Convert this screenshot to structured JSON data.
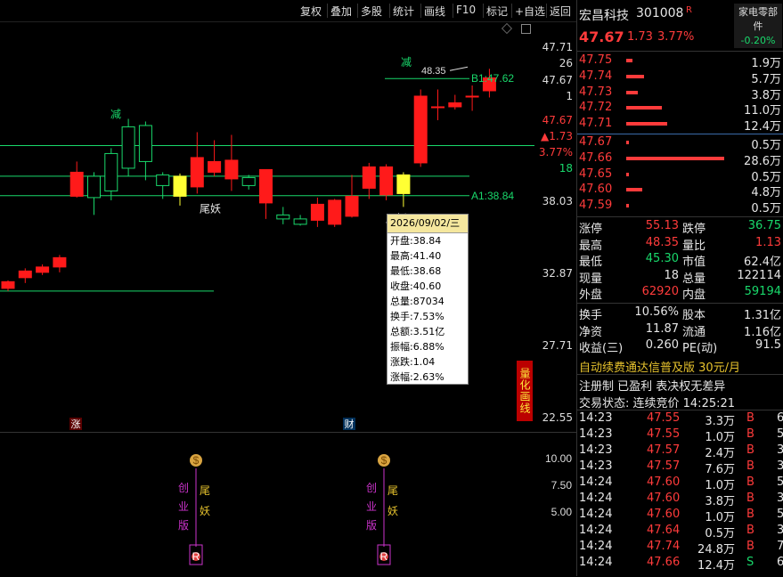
{
  "toolbar": {
    "items": [
      "复权",
      "叠加",
      "多股",
      "统计",
      "画线",
      "F10",
      "标记",
      "+自选",
      "返回"
    ]
  },
  "chart_data": {
    "type": "candlestick",
    "candles": [
      {
        "o": 31.9,
        "c": 32.4,
        "h": 32.5,
        "l": 31.7
      },
      {
        "o": 32.7,
        "c": 33.2,
        "h": 33.4,
        "l": 32.3
      },
      {
        "o": 33.1,
        "c": 33.5,
        "h": 33.7,
        "l": 32.9
      },
      {
        "o": 33.5,
        "c": 34.2,
        "h": 34.4,
        "l": 33.1
      },
      {
        "o": 38.8,
        "c": 40.6,
        "h": 41.4,
        "l": 38.7
      },
      {
        "o": 40.3,
        "c": 38.7,
        "h": 40.6,
        "l": 37.4
      },
      {
        "o": 42.0,
        "c": 39.2,
        "h": 42.4,
        "l": 38.5
      },
      {
        "o": 44.0,
        "c": 40.9,
        "h": 44.6,
        "l": 40.3
      },
      {
        "o": 44.1,
        "c": 41.4,
        "h": 44.4,
        "l": 40.0
      },
      {
        "o": 40.4,
        "c": 39.6,
        "h": 40.6,
        "l": 38.6
      },
      {
        "o": 40.3,
        "c": 38.8,
        "h": 40.5,
        "l": 38.1
      },
      {
        "o": 39.5,
        "c": 41.7,
        "h": 43.6,
        "l": 39.0
      },
      {
        "o": 40.6,
        "c": 41.4,
        "h": 43.0,
        "l": 40.3
      },
      {
        "o": 40.1,
        "c": 41.5,
        "h": 43.4,
        "l": 39.2
      },
      {
        "o": 40.2,
        "c": 39.6,
        "h": 40.4,
        "l": 39.3
      },
      {
        "o": 38.3,
        "c": 40.8,
        "h": 40.8,
        "l": 37.1
      },
      {
        "o": 37.4,
        "c": 37.1,
        "h": 38.0,
        "l": 36.7
      },
      {
        "o": 37.1,
        "c": 36.7,
        "h": 37.4,
        "l": 36.6
      },
      {
        "o": 37.0,
        "c": 38.2,
        "h": 38.7,
        "l": 36.5
      },
      {
        "o": 36.7,
        "c": 38.5,
        "h": 38.6,
        "l": 36.5
      },
      {
        "o": 37.3,
        "c": 38.8,
        "h": 40.4,
        "l": 37.2
      },
      {
        "o": 39.4,
        "c": 41.0,
        "h": 41.3,
        "l": 38.6
      },
      {
        "o": 38.9,
        "c": 41.0,
        "h": 41.2,
        "l": 38.5
      },
      {
        "o": 40.4,
        "c": 39.0,
        "h": 40.6,
        "l": 38.0
      },
      {
        "o": 41.3,
        "c": 46.3,
        "h": 46.8,
        "l": 41.0
      },
      {
        "o": 45.5,
        "c": 45.5,
        "h": 46.8,
        "l": 44.5
      },
      {
        "o": 45.5,
        "c": 45.8,
        "h": 46.4,
        "l": 45.3
      },
      {
        "o": 46.3,
        "c": 46.3,
        "h": 47.1,
        "l": 45.2
      },
      {
        "o": 46.7,
        "c": 47.67,
        "h": 48.35,
        "l": 46.2
      }
    ],
    "ylim": [
      22.55,
      48.9
    ],
    "hlines": [
      {
        "y": 42.6,
        "color": "#19d86b"
      },
      {
        "y": 40.3,
        "color": "#19d86b"
      },
      {
        "y": 38.84,
        "color": "#19d86b"
      },
      {
        "y": 31.7,
        "color": "#19d86b"
      },
      {
        "y": 47.62,
        "color": "#19d86b"
      }
    ],
    "yticks": [
      "47.71",
      "26",
      "47.67",
      "1",
      "47.67",
      "▲1.73",
      "3.77%",
      "18",
      "38.03",
      "32.87",
      "27.71",
      "22.55"
    ],
    "annotations": {
      "b1": "B1:47.62",
      "a1": "A1:38.84",
      "high": "48.35",
      "jian": "减",
      "weiyao": "尾妖",
      "zhang": "涨",
      "cai": "财"
    },
    "sub_ticks": [
      "10.00",
      "7.50",
      "5.00"
    ]
  },
  "tooltip": {
    "date": "2026/09/02/三",
    "lines": [
      "开盘:38.84",
      "最高:41.40",
      "最低:38.68",
      "收盘:40.60",
      "总量:87034",
      "换手:7.53%",
      "总额:3.51亿",
      "振幅:6.88%",
      "涨跌:1.04",
      "涨幅:2.63%"
    ]
  },
  "badge": "量化画线",
  "sub_labels": {
    "cy": [
      "创",
      "业",
      "版"
    ],
    "wy": [
      "尾",
      "妖"
    ],
    "r": "R",
    "money": "$"
  },
  "stock": {
    "name": "宏昌科技",
    "code": "301008",
    "mark": "R",
    "sector": "家电零部件",
    "sector_change": "-0.20%",
    "price": "47.67",
    "change": "1.73",
    "pct": "3.77%"
  },
  "asks": [
    {
      "p": "47.75",
      "v": "1.9万",
      "w": 0.03
    },
    {
      "p": "47.74",
      "v": "5.7万",
      "w": 0.09
    },
    {
      "p": "47.73",
      "v": "3.8万",
      "w": 0.06
    },
    {
      "p": "47.72",
      "v": "11.0万",
      "w": 0.18
    },
    {
      "p": "47.71",
      "v": "12.4万",
      "w": 0.21
    }
  ],
  "bids": [
    {
      "p": "47.67",
      "v": "0.5万",
      "w": 0.01
    },
    {
      "p": "47.66",
      "v": "28.6万",
      "w": 0.5
    },
    {
      "p": "47.65",
      "v": "0.5万",
      "w": 0.01
    },
    {
      "p": "47.60",
      "v": "4.8万",
      "w": 0.08
    },
    {
      "p": "47.59",
      "v": "0.5万",
      "w": 0.01
    }
  ],
  "stats": [
    [
      [
        "涨停",
        "55.13",
        "red"
      ],
      [
        "跌停",
        "36.75",
        "green"
      ]
    ],
    [
      [
        "最高",
        "48.35",
        "red"
      ],
      [
        "量比",
        "1.13",
        "red"
      ]
    ],
    [
      [
        "最低",
        "45.30",
        "green"
      ],
      [
        "市值",
        "62.4亿",
        "white"
      ]
    ],
    [
      [
        "现量",
        "18",
        "white"
      ],
      [
        "总量",
        "122114",
        "white"
      ]
    ],
    [
      [
        "外盘",
        "62920",
        "red"
      ],
      [
        "内盘",
        "59194",
        "green"
      ]
    ]
  ],
  "stats2": [
    [
      [
        "换手",
        "10.56%",
        "white"
      ],
      [
        "股本",
        "1.31亿",
        "white"
      ]
    ],
    [
      [
        "净资",
        "11.87",
        "white"
      ],
      [
        "流通",
        "1.16亿",
        "white"
      ]
    ],
    [
      [
        "收益(三)",
        "0.260",
        "white"
      ],
      [
        "PE(动)",
        "91.5",
        "white"
      ]
    ]
  ],
  "promo": "自动续费通达信普及版 30元/月",
  "tags": "注册制 已盈利 表决权无差异",
  "trade_status": "交易状态: 连续竞价 14:25:21",
  "ticks": [
    [
      "14:23",
      "47.55",
      "3.3万",
      "B",
      "6"
    ],
    [
      "14:23",
      "47.55",
      "1.0万",
      "B",
      "5"
    ],
    [
      "14:23",
      "47.57",
      "2.4万",
      "B",
      "3"
    ],
    [
      "14:23",
      "47.57",
      "7.6万",
      "B",
      "3"
    ],
    [
      "14:24",
      "47.60",
      "1.0万",
      "B",
      "5"
    ],
    [
      "14:24",
      "47.60",
      "3.8万",
      "B",
      "3"
    ],
    [
      "14:24",
      "47.60",
      "1.0万",
      "B",
      "5"
    ],
    [
      "14:24",
      "47.64",
      "0.5万",
      "B",
      "3"
    ],
    [
      "14:24",
      "47.74",
      "24.8万",
      "B",
      "7"
    ],
    [
      "14:24",
      "47.66",
      "12.4万",
      "S",
      "6"
    ]
  ]
}
